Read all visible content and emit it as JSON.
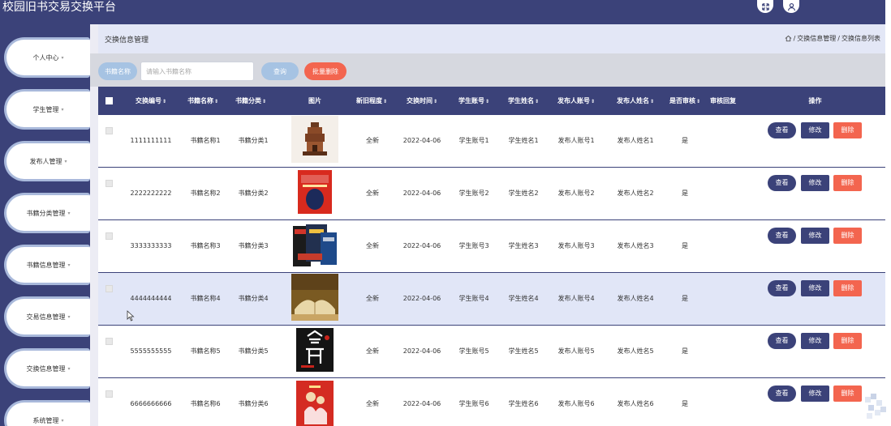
{
  "app": {
    "title": "校园旧书交易交换平台"
  },
  "topbar": {
    "icons": [
      "fullscreen-icon",
      "user-icon"
    ]
  },
  "sidebar": {
    "items": [
      {
        "label": "个人中心"
      },
      {
        "label": "学生管理"
      },
      {
        "label": "发布人管理"
      },
      {
        "label": "书籍分类管理"
      },
      {
        "label": "书籍信息管理"
      },
      {
        "label": "交易信息管理"
      },
      {
        "label": "交换信息管理"
      },
      {
        "label": "系统管理"
      }
    ],
    "caret": "▾"
  },
  "page": {
    "title": "交换信息管理",
    "breadcrumb": [
      {
        "label": "交换信息管理"
      },
      {
        "label": "交换信息列表"
      }
    ],
    "breadcrumb_sep": "/"
  },
  "search": {
    "label": "书籍名称",
    "placeholder": "请输入书籍名称",
    "value": "",
    "query_button": "查询",
    "batch_delete_button": "批量删除"
  },
  "table": {
    "sort_glyph": "⇕",
    "columns": [
      {
        "label": "交换编号",
        "sortable": true
      },
      {
        "label": "书籍名称",
        "sortable": true
      },
      {
        "label": "书籍分类",
        "sortable": true
      },
      {
        "label": "图片",
        "sortable": false
      },
      {
        "label": "新旧程度",
        "sortable": true
      },
      {
        "label": "交换时间",
        "sortable": true
      },
      {
        "label": "学生账号",
        "sortable": true
      },
      {
        "label": "学生姓名",
        "sortable": true
      },
      {
        "label": "发布人账号",
        "sortable": true
      },
      {
        "label": "发布人姓名",
        "sortable": true
      },
      {
        "label": "是否审核",
        "sortable": true
      },
      {
        "label": "审核回复",
        "sortable": false
      },
      {
        "label": "操作",
        "sortable": false
      }
    ],
    "actions": {
      "view": "查看",
      "edit": "修改",
      "delete": "删除"
    },
    "rows": [
      {
        "id": "1111111111",
        "book": "书籍名称1",
        "category": "书籍分类1",
        "image": "book-cover-pagoda",
        "condition": "全新",
        "time": "2022-04-06",
        "student_account": "学生账号1",
        "student_name": "学生姓名1",
        "publisher_account": "发布人账号1",
        "publisher_name": "发布人姓名1",
        "reviewed": "是",
        "reply": ""
      },
      {
        "id": "2222222222",
        "book": "书籍名称2",
        "category": "书籍分类2",
        "image": "book-cover-red-head",
        "condition": "全新",
        "time": "2022-04-06",
        "student_account": "学生账号2",
        "student_name": "学生姓名2",
        "publisher_account": "发布人账号2",
        "publisher_name": "发布人姓名2",
        "reviewed": "是",
        "reply": ""
      },
      {
        "id": "3333333333",
        "book": "书籍名称3",
        "category": "书籍分类3",
        "image": "book-cover-stack",
        "condition": "全新",
        "time": "2022-04-06",
        "student_account": "学生账号3",
        "student_name": "学生姓名3",
        "publisher_account": "发布人账号3",
        "publisher_name": "发布人姓名3",
        "reviewed": "是",
        "reply": ""
      },
      {
        "id": "4444444444",
        "book": "书籍名称4",
        "category": "书籍分类4",
        "image": "book-cover-open-book",
        "condition": "全新",
        "time": "2022-04-06",
        "student_account": "学生账号4",
        "student_name": "学生姓名4",
        "publisher_account": "发布人账号4",
        "publisher_name": "发布人姓名4",
        "reviewed": "是",
        "reply": "",
        "highlighted": true
      },
      {
        "id": "5555555555",
        "book": "书籍名称5",
        "category": "书籍分类5",
        "image": "book-cover-black-calligraphy",
        "condition": "全新",
        "time": "2022-04-06",
        "student_account": "学生账号5",
        "student_name": "学生姓名5",
        "publisher_account": "发布人账号5",
        "publisher_name": "发布人姓名5",
        "reviewed": "是",
        "reply": ""
      },
      {
        "id": "6666666666",
        "book": "书籍名称6",
        "category": "书籍分类6",
        "image": "book-cover-red-figures",
        "condition": "全新",
        "time": "2022-04-06",
        "student_account": "学生账号6",
        "student_name": "学生姓名6",
        "publisher_account": "发布人账号6",
        "publisher_name": "发布人姓名6",
        "reviewed": "是",
        "reply": ""
      }
    ]
  },
  "colors": {
    "primary": "#3b4279",
    "light_blue": "#a6c3e3",
    "danger": "#f3654f",
    "breadcrumb_bg": "#e3e7f6",
    "search_bg": "#d6d8df",
    "row_highlight": "#e1e6f7"
  }
}
